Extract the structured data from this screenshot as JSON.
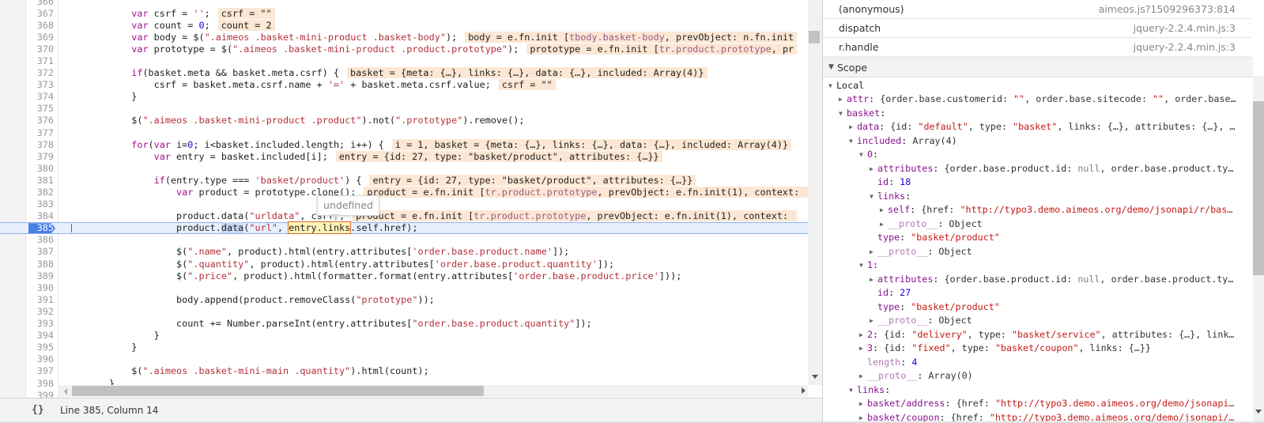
{
  "editor": {
    "lines": [
      {
        "n": "366",
        "indent": 0,
        "code": [],
        "ann": []
      },
      {
        "n": "367",
        "indent": 12,
        "code": [
          [
            "kw",
            "var"
          ],
          [
            "t",
            " csrf = "
          ],
          [
            "s",
            "''"
          ],
          [
            "t",
            ";"
          ]
        ],
        "ann": [
          [
            "t",
            "csrf = \"\""
          ]
        ]
      },
      {
        "n": "368",
        "indent": 12,
        "code": [
          [
            "kw",
            "var"
          ],
          [
            "t",
            " count = "
          ],
          [
            "n",
            "0"
          ],
          [
            "t",
            ";"
          ]
        ],
        "ann": [
          [
            "t",
            "count = 2"
          ]
        ]
      },
      {
        "n": "369",
        "indent": 12,
        "code": [
          [
            "kw",
            "var"
          ],
          [
            "t",
            " body = $("
          ],
          [
            "s",
            "\".aimeos .basket-mini-product .basket-body\""
          ],
          [
            "t",
            ");"
          ]
        ],
        "ann": [
          [
            "t",
            "body = e.fn.init ["
          ],
          [
            "el",
            "tbody.basket-body"
          ],
          [
            "t",
            ", prevObject: n.fn.init"
          ]
        ]
      },
      {
        "n": "370",
        "indent": 12,
        "code": [
          [
            "kw",
            "var"
          ],
          [
            "t",
            " prototype = $("
          ],
          [
            "s",
            "\".aimeos .basket-mini-product .product.prototype\""
          ],
          [
            "t",
            ");"
          ]
        ],
        "ann": [
          [
            "t",
            "prototype = e.fn.init ["
          ],
          [
            "el",
            "tr.product.prototype"
          ],
          [
            "t",
            ", pr"
          ]
        ]
      },
      {
        "n": "371",
        "indent": 0,
        "code": [],
        "ann": []
      },
      {
        "n": "372",
        "indent": 12,
        "code": [
          [
            "kw",
            "if"
          ],
          [
            "t",
            "(basket.meta && basket.meta.csrf) {"
          ]
        ],
        "ann": [
          [
            "t",
            "basket = {meta: {…}, links: {…}, data: {…}, included: Array(4)}"
          ]
        ]
      },
      {
        "n": "373",
        "indent": 16,
        "code": [
          [
            "t",
            "csrf = basket.meta.csrf.name + "
          ],
          [
            "s",
            "'='"
          ],
          [
            "t",
            " + basket.meta.csrf.value;"
          ]
        ],
        "ann": [
          [
            "t",
            "csrf = \"\""
          ]
        ]
      },
      {
        "n": "374",
        "indent": 12,
        "code": [
          [
            "t",
            "}"
          ]
        ],
        "ann": []
      },
      {
        "n": "375",
        "indent": 0,
        "code": [],
        "ann": []
      },
      {
        "n": "376",
        "indent": 12,
        "code": [
          [
            "t",
            "$("
          ],
          [
            "s",
            "\".aimeos .basket-mini-product .product\""
          ],
          [
            "t",
            ").not("
          ],
          [
            "s",
            "\".prototype\""
          ],
          [
            "t",
            ").remove();"
          ]
        ],
        "ann": []
      },
      {
        "n": "377",
        "indent": 0,
        "code": [],
        "ann": []
      },
      {
        "n": "378",
        "indent": 12,
        "code": [
          [
            "kw",
            "for"
          ],
          [
            "t",
            "("
          ],
          [
            "kw",
            "var"
          ],
          [
            "t",
            " i="
          ],
          [
            "n",
            "0"
          ],
          [
            "t",
            "; i<basket.included.length; i++) {"
          ]
        ],
        "ann": [
          [
            "t",
            "i = 1, basket = {meta: {…}, links: {…}, data: {…}, included: Array(4)}"
          ]
        ]
      },
      {
        "n": "379",
        "indent": 16,
        "code": [
          [
            "kw",
            "var"
          ],
          [
            "t",
            " entry = basket.included[i];"
          ]
        ],
        "ann": [
          [
            "t",
            "entry = {id: 27, type: \"basket/product\", attributes: {…}}"
          ]
        ]
      },
      {
        "n": "380",
        "indent": 0,
        "code": [],
        "ann": []
      },
      {
        "n": "381",
        "indent": 16,
        "code": [
          [
            "kw",
            "if"
          ],
          [
            "t",
            "(entry.type === "
          ],
          [
            "s",
            "'basket/product'"
          ],
          [
            "t",
            ") {"
          ]
        ],
        "ann": [
          [
            "t",
            "entry = {id: 27, type: \"basket/product\", attributes: {…}}"
          ]
        ]
      },
      {
        "n": "382",
        "indent": 20,
        "code": [
          [
            "kw",
            "var"
          ],
          [
            "t",
            " product = prototype.clone();"
          ]
        ],
        "ann": [
          [
            "t",
            "product = e.fn.init ["
          ],
          [
            "el",
            "tr.product.prototype"
          ],
          [
            "t",
            ", prevObject: e.fn.init(1), context: "
          ]
        ]
      },
      {
        "n": "383",
        "indent": 0,
        "code": [],
        "ann": []
      },
      {
        "n": "384",
        "indent": 20,
        "code": [
          [
            "t",
            "product.data("
          ],
          [
            "s",
            "\"urldata\""
          ],
          [
            "t",
            ", csrf);"
          ]
        ],
        "ann": [
          [
            "t",
            "product = e.fn.init ["
          ],
          [
            "el",
            "tr.product.prototype"
          ],
          [
            "t",
            ", prevObject: e.fn.init(1), context: "
          ]
        ]
      },
      {
        "n": "385",
        "indent": 20,
        "exec": true,
        "code": [
          [
            "t",
            "product."
          ],
          [
            "sel",
            "data"
          ],
          [
            "t",
            "("
          ],
          [
            "s",
            "\"url\""
          ],
          [
            "t",
            ", "
          ],
          [
            "hl",
            "entry.links"
          ],
          [
            "t",
            ".self.href);"
          ]
        ],
        "ann": []
      },
      {
        "n": "386",
        "indent": 0,
        "code": [],
        "ann": []
      },
      {
        "n": "387",
        "indent": 20,
        "code": [
          [
            "t",
            "$("
          ],
          [
            "s",
            "\".name\""
          ],
          [
            "t",
            ", product).html(entry.attributes["
          ],
          [
            "s",
            "'order.base.product.name'"
          ],
          [
            "t",
            "]);"
          ]
        ],
        "ann": []
      },
      {
        "n": "388",
        "indent": 20,
        "code": [
          [
            "t",
            "$("
          ],
          [
            "s",
            "\".quantity\""
          ],
          [
            "t",
            ", product).html(entry.attributes["
          ],
          [
            "s",
            "'order.base.product.quantity'"
          ],
          [
            "t",
            "]);"
          ]
        ],
        "ann": []
      },
      {
        "n": "389",
        "indent": 20,
        "code": [
          [
            "t",
            "$("
          ],
          [
            "s",
            "\".price\""
          ],
          [
            "t",
            ", product).html(formatter.format(entry.attributes["
          ],
          [
            "s",
            "'order.base.product.price'"
          ],
          [
            "t",
            "]));"
          ]
        ],
        "ann": []
      },
      {
        "n": "390",
        "indent": 0,
        "code": [],
        "ann": []
      },
      {
        "n": "391",
        "indent": 20,
        "code": [
          [
            "t",
            "body.append(product.removeClass("
          ],
          [
            "s",
            "\"prototype\""
          ],
          [
            "t",
            "));"
          ]
        ],
        "ann": []
      },
      {
        "n": "392",
        "indent": 0,
        "code": [],
        "ann": []
      },
      {
        "n": "393",
        "indent": 20,
        "code": [
          [
            "t",
            "count += Number.parseInt(entry.attributes["
          ],
          [
            "s",
            "\"order.base.product.quantity\""
          ],
          [
            "t",
            "]);"
          ]
        ],
        "ann": []
      },
      {
        "n": "394",
        "indent": 16,
        "code": [
          [
            "t",
            "}"
          ]
        ],
        "ann": []
      },
      {
        "n": "395",
        "indent": 12,
        "code": [
          [
            "t",
            "}"
          ]
        ],
        "ann": []
      },
      {
        "n": "396",
        "indent": 0,
        "code": [],
        "ann": []
      },
      {
        "n": "397",
        "indent": 12,
        "code": [
          [
            "t",
            "$("
          ],
          [
            "s",
            "\".aimeos .basket-mini-main .quantity\""
          ],
          [
            "t",
            ").html(count);"
          ]
        ],
        "ann": []
      },
      {
        "n": "398",
        "indent": 8,
        "code": [
          [
            "t",
            "}"
          ]
        ],
        "ann": []
      },
      {
        "n": "399",
        "indent": 0,
        "code": [],
        "ann": []
      }
    ],
    "hover_tooltip": "undefined"
  },
  "statusbar": {
    "pretty_print_icon": "{}",
    "cursor_position": "Line 385, Column 14"
  },
  "call_stack": [
    {
      "function": "(anonymous)",
      "location": "aimeos.js?1509296373:814"
    },
    {
      "function": "dispatch",
      "location": "jquery-2.2.4.min.js:3"
    },
    {
      "function": "r.handle",
      "location": "jquery-2.2.4.min.js:3"
    }
  ],
  "scope": {
    "title": "Scope",
    "tree": [
      {
        "d": 0,
        "arrow": "open",
        "key": "Local",
        "kc": "plain",
        "sep": "",
        "val": []
      },
      {
        "d": 1,
        "arrow": "closed",
        "key": "attr",
        "val": [
          [
            "t",
            "{order.base.customerid: "
          ],
          [
            "s",
            "\"\""
          ],
          [
            "t",
            ", order.base.sitecode: "
          ],
          [
            "s",
            "\"\""
          ],
          [
            "t",
            ", order.base…"
          ]
        ]
      },
      {
        "d": 1,
        "arrow": "open",
        "key": "basket",
        "val": []
      },
      {
        "d": 2,
        "arrow": "closed",
        "key": "data",
        "val": [
          [
            "t",
            "{id: "
          ],
          [
            "s",
            "\"default\""
          ],
          [
            "t",
            ", type: "
          ],
          [
            "s",
            "\"basket\""
          ],
          [
            "t",
            ", links: {…}, attributes: {…}, …"
          ]
        ]
      },
      {
        "d": 2,
        "arrow": "open",
        "key": "included",
        "val": [
          [
            "t",
            "Array(4)"
          ]
        ]
      },
      {
        "d": 3,
        "arrow": "open",
        "key": "0",
        "val": []
      },
      {
        "d": 4,
        "arrow": "closed",
        "key": "attributes",
        "val": [
          [
            "t",
            "{order.base.product.id: "
          ],
          [
            "null",
            "null"
          ],
          [
            "t",
            ", order.base.product.ty…"
          ]
        ]
      },
      {
        "d": 4,
        "arrow": null,
        "key": "id",
        "val": [
          [
            "n",
            "18"
          ]
        ]
      },
      {
        "d": 4,
        "arrow": "open",
        "key": "links",
        "val": []
      },
      {
        "d": 5,
        "arrow": "closed",
        "key": "self",
        "val": [
          [
            "t",
            "{href: "
          ],
          [
            "s",
            "\"http://typo3.demo.aimeos.org/demo/jsonapi/r/bas…"
          ]
        ]
      },
      {
        "d": 5,
        "arrow": "closed",
        "key": "__proto__",
        "kc": "dim",
        "val": [
          [
            "t",
            "Object"
          ]
        ]
      },
      {
        "d": 4,
        "arrow": null,
        "key": "type",
        "val": [
          [
            "s",
            "\"basket/product\""
          ]
        ]
      },
      {
        "d": 4,
        "arrow": "closed",
        "key": "__proto__",
        "kc": "dim",
        "val": [
          [
            "t",
            "Object"
          ]
        ]
      },
      {
        "d": 3,
        "arrow": "open",
        "key": "1",
        "val": []
      },
      {
        "d": 4,
        "arrow": "closed",
        "key": "attributes",
        "val": [
          [
            "t",
            "{order.base.product.id: "
          ],
          [
            "null",
            "null"
          ],
          [
            "t",
            ", order.base.product.ty…"
          ]
        ]
      },
      {
        "d": 4,
        "arrow": null,
        "key": "id",
        "val": [
          [
            "n",
            "27"
          ]
        ]
      },
      {
        "d": 4,
        "arrow": null,
        "key": "type",
        "val": [
          [
            "s",
            "\"basket/product\""
          ]
        ]
      },
      {
        "d": 4,
        "arrow": "closed",
        "key": "__proto__",
        "kc": "dim",
        "val": [
          [
            "t",
            "Object"
          ]
        ]
      },
      {
        "d": 3,
        "arrow": "closed",
        "key": "2",
        "val": [
          [
            "t",
            "{id: "
          ],
          [
            "s",
            "\"delivery\""
          ],
          [
            "t",
            ", type: "
          ],
          [
            "s",
            "\"basket/service\""
          ],
          [
            "t",
            ", attributes: {…}, link…"
          ]
        ]
      },
      {
        "d": 3,
        "arrow": "closed",
        "key": "3",
        "val": [
          [
            "t",
            "{id: "
          ],
          [
            "s",
            "\"fixed\""
          ],
          [
            "t",
            ", type: "
          ],
          [
            "s",
            "\"basket/coupon\""
          ],
          [
            "t",
            ", links: {…}}"
          ]
        ]
      },
      {
        "d": 3,
        "arrow": null,
        "key": "length",
        "kc": "dim",
        "val": [
          [
            "n",
            "4"
          ]
        ]
      },
      {
        "d": 3,
        "arrow": "closed",
        "key": "__proto__",
        "kc": "dim",
        "val": [
          [
            "t",
            "Array(0)"
          ]
        ]
      },
      {
        "d": 2,
        "arrow": "open",
        "key": "links",
        "val": []
      },
      {
        "d": 3,
        "arrow": "closed",
        "key": "basket/address",
        "val": [
          [
            "t",
            "{href: "
          ],
          [
            "s",
            "\"http://typo3.demo.aimeos.org/demo/jsonapi…"
          ]
        ]
      },
      {
        "d": 3,
        "arrow": "closed",
        "key": "basket/coupon",
        "val": [
          [
            "t",
            "{href: "
          ],
          [
            "s",
            "\"http://typo3.demo.aimeos.org/demo/jsonapi/…"
          ]
        ]
      }
    ]
  }
}
